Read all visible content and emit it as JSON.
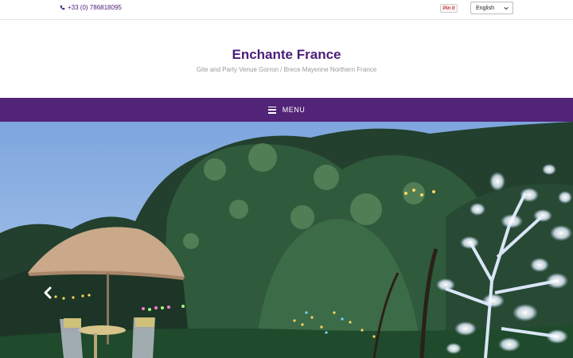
{
  "topbar": {
    "phone": "+33 (0) 786818095",
    "pinit_label": "Pin it",
    "language": "English"
  },
  "header": {
    "title": "Enchante France",
    "tagline": "Gite and Party Venue Gorron / Brece Mayenne Northern France"
  },
  "nav": {
    "menu_label": "MENU"
  },
  "colors": {
    "brand_purple": "#522478",
    "title_purple": "#4b1d78",
    "tagline_gray": "#9a9a9a"
  },
  "icons": {
    "phone": "phone-icon",
    "menu": "hamburger-icon",
    "prev": "chevron-left-icon",
    "select": "chevron-down-icon"
  }
}
